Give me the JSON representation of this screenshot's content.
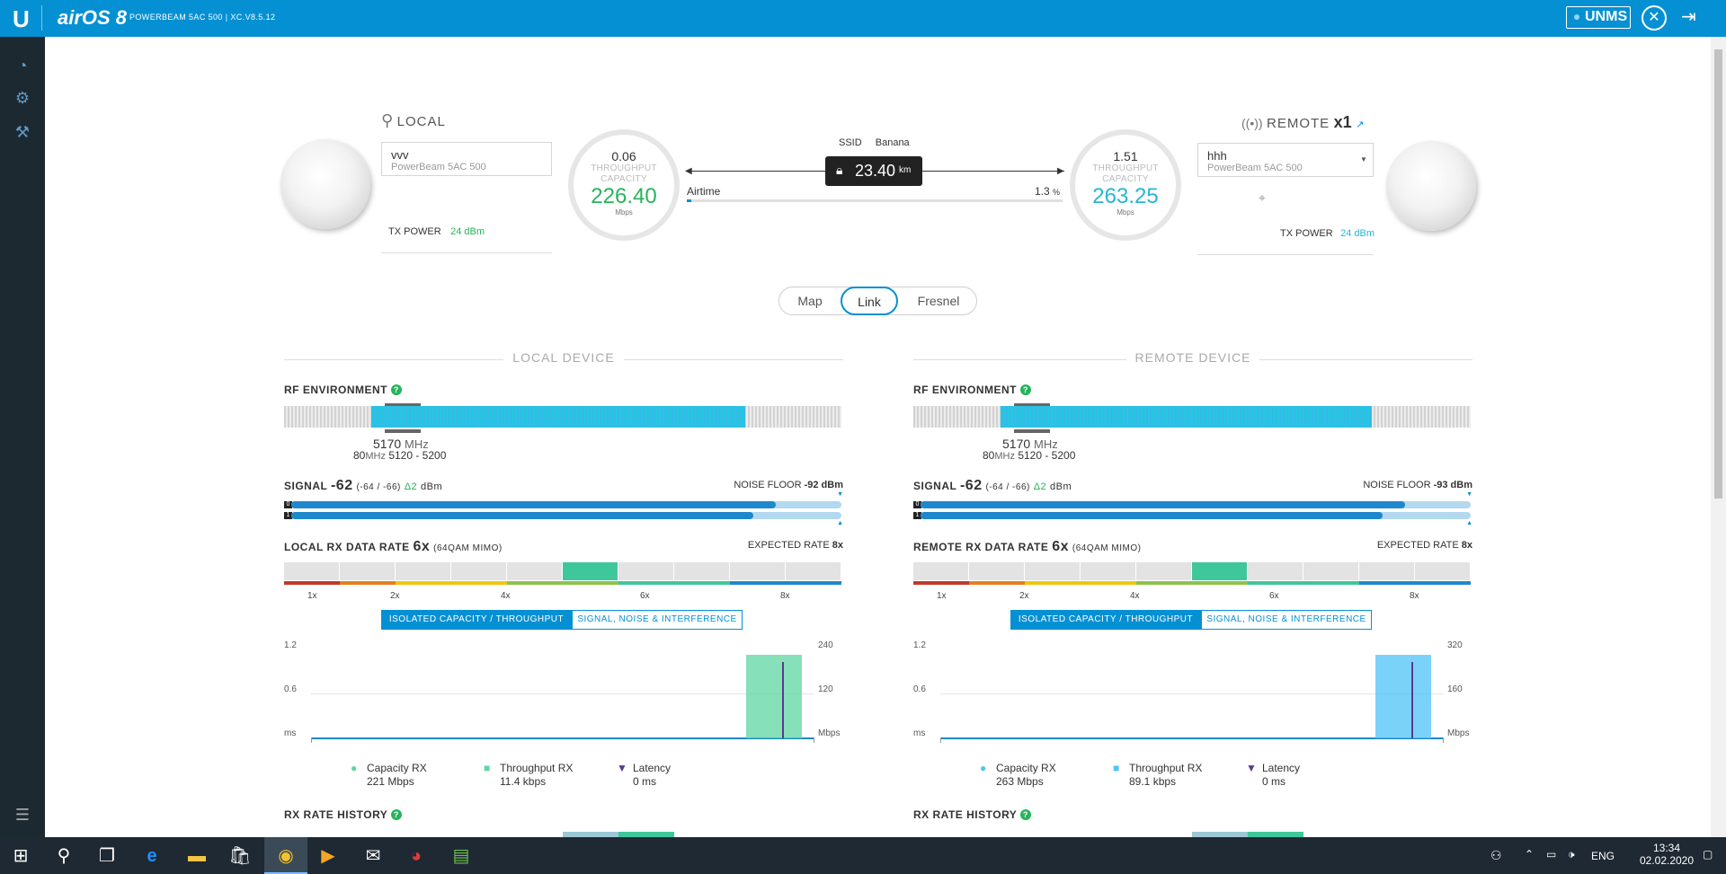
{
  "topbar": {
    "logo_text": "U",
    "product": "airOS 8",
    "device_title": "POWERBEAM 5AC 500 | XC.V8.5.12",
    "unms_label": "UNMS",
    "tools_icon": "tools-icon",
    "logout_icon": "logout-icon"
  },
  "sidebar": {
    "items": [
      {
        "icon": "dashboard-icon"
      },
      {
        "icon": "settings-gears-icon"
      },
      {
        "icon": "wand-tools-icon"
      },
      {
        "icon": "log-icon"
      }
    ]
  },
  "link": {
    "local": {
      "header": "LOCAL",
      "name": "vvv",
      "model": "PowerBeam 5AC 500",
      "tx_power_label": "TX POWER",
      "tx_power_value": "24 dBm",
      "throughput": "0.06",
      "throughput_label": "THROUGHPUT",
      "capacity_label": "CAPACITY",
      "capacity": "226.40",
      "unit": "Mbps"
    },
    "remote": {
      "header": "REMOTE",
      "count": "x1",
      "name": "hhh",
      "model": "PowerBeam 5AC 500",
      "tx_power_label": "TX POWER",
      "tx_power_value": "24 dBm",
      "throughput": "1.51",
      "throughput_label": "THROUGHPUT",
      "capacity_label": "CAPACITY",
      "capacity": "263.25",
      "unit": "Mbps"
    },
    "ssid_label": "SSID",
    "ssid": "Banana",
    "distance": "23.40",
    "distance_unit": "km",
    "airtime_label": "Airtime",
    "airtime_value": "1.3",
    "airtime_unit": "%"
  },
  "tabs": [
    {
      "label": "Map"
    },
    {
      "label": "Link"
    },
    {
      "label": "Fresnel"
    }
  ],
  "panels": [
    {
      "title": "LOCAL DEVICE",
      "rf_label": "RF ENVIRONMENT",
      "help": "?",
      "freq": "5170",
      "freq_unit": "MHz",
      "width": "80",
      "width_unit": "MHz",
      "range": "5120 - 5200",
      "signal_label": "SIGNAL",
      "signal": "-62",
      "signal_chains": "(-64 / -66)",
      "signal_delta": "Δ2",
      "signal_unit": "dBm",
      "noise_label": "NOISE FLOOR",
      "noise_value": "-92 dBm",
      "chain0": "0",
      "chain1": "1",
      "chain0_level": 0.88,
      "chain1_level": 0.84,
      "rate_label": "LOCAL RX DATA RATE",
      "rate_value": "6x",
      "rate_mod": "(64QAM MIMO)",
      "expected_label": "EXPECTED RATE",
      "expected_value": "8x",
      "rate_ticks": [
        "1x",
        "2x",
        "4x",
        "6x",
        "8x"
      ],
      "seg_on": "ISOLATED CAPACITY / THROUGHPUT",
      "seg_off": "SIGNAL, NOISE & INTERFERENCE",
      "y_left": [
        "1.2",
        "0.6",
        "ms"
      ],
      "y_right": [
        "240",
        "120",
        "Mbps"
      ],
      "legend": [
        {
          "name": "Capacity RX",
          "value": "221 Mbps"
        },
        {
          "name": "Throughput RX",
          "value": "11.4 kbps"
        },
        {
          "name": "Latency",
          "value": "0 ms"
        }
      ],
      "history_label": "RX RATE HISTORY",
      "accent": "#5dd6a1"
    },
    {
      "title": "REMOTE DEVICE",
      "rf_label": "RF ENVIRONMENT",
      "help": "?",
      "freq": "5170",
      "freq_unit": "MHz",
      "width": "80",
      "width_unit": "MHz",
      "range": "5120 - 5200",
      "signal_label": "SIGNAL",
      "signal": "-62",
      "signal_chains": "(-64 / -66)",
      "signal_delta": "Δ2",
      "signal_unit": "dBm",
      "noise_label": "NOISE FLOOR",
      "noise_value": "-93 dBm",
      "chain0": "0",
      "chain1": "1",
      "chain0_level": 0.88,
      "chain1_level": 0.84,
      "rate_label": "REMOTE RX DATA RATE",
      "rate_value": "6x",
      "rate_mod": "(64QAM MIMO)",
      "expected_label": "EXPECTED RATE",
      "expected_value": "8x",
      "rate_ticks": [
        "1x",
        "2x",
        "4x",
        "6x",
        "8x"
      ],
      "seg_on": "ISOLATED CAPACITY / THROUGHPUT",
      "seg_off": "SIGNAL, NOISE & INTERFERENCE",
      "y_left": [
        "1.2",
        "0.6",
        "ms"
      ],
      "y_right": [
        "320",
        "160",
        "Mbps"
      ],
      "legend": [
        {
          "name": "Capacity RX",
          "value": "263 Mbps"
        },
        {
          "name": "Throughput RX",
          "value": "89.1 kbps"
        },
        {
          "name": "Latency",
          "value": "0 ms"
        }
      ],
      "history_label": "RX RATE HISTORY",
      "accent": "#4fc3f7"
    }
  ],
  "taskbar": {
    "lang": "ENG",
    "time": "13:34",
    "date": "02.02.2020"
  },
  "colors": {
    "brand": "#0590d3",
    "sidebar": "#1d2931",
    "green": "#27b35c",
    "teal": "#27b6d1"
  }
}
